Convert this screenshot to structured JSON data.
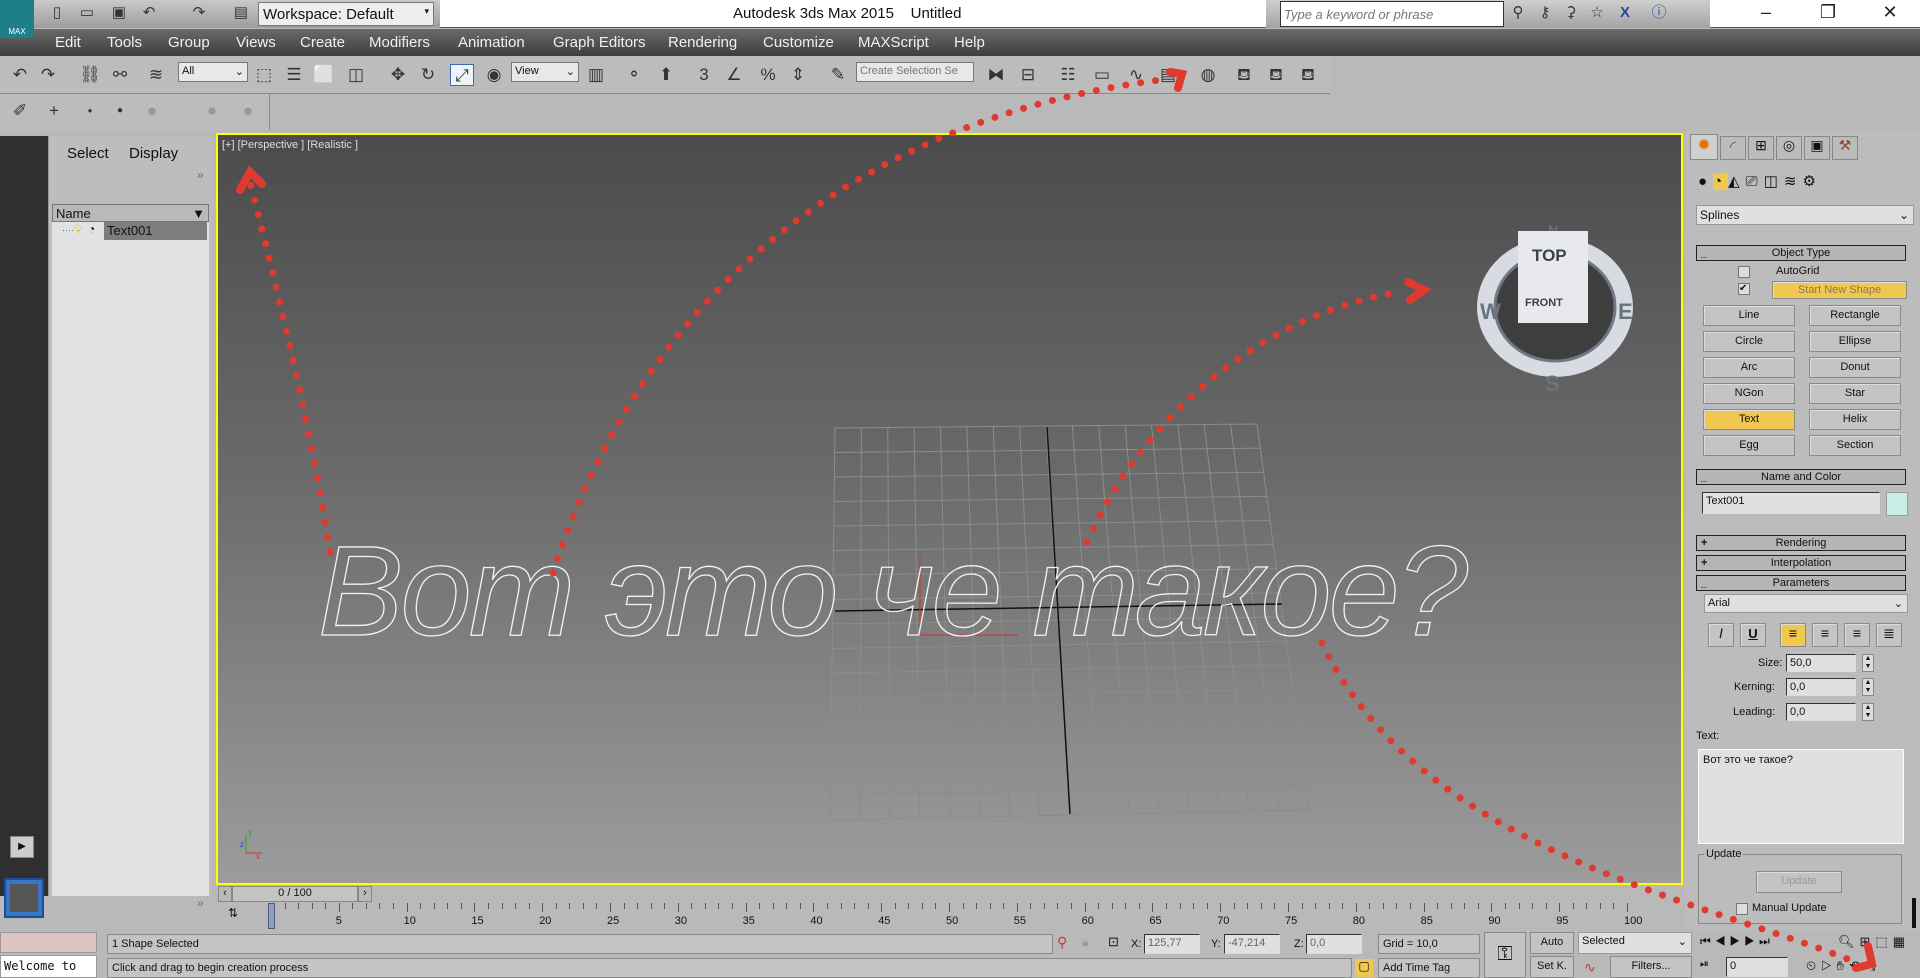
{
  "app": {
    "title": "Autodesk 3ds Max  2015",
    "document": "Untitled",
    "logo": "MAX",
    "workspace": "Workspace: Default",
    "search_placeholder": "Type a keyword or phrase"
  },
  "menu": [
    "Edit",
    "Tools",
    "Group",
    "Views",
    "Create",
    "Modifiers",
    "Animation",
    "Graph Editors",
    "Rendering",
    "Customize",
    "MAXScript",
    "Help"
  ],
  "toolbar": {
    "selection_filter": "All",
    "ref_coord": "View",
    "named_selection_placeholder": "Create Selection Se",
    "snap_3": "3",
    "snap_percent": "%"
  },
  "explorer": {
    "tabs": [
      "Select",
      "Display"
    ],
    "column": "Name",
    "items": [
      {
        "name": "Text001"
      }
    ]
  },
  "viewport": {
    "label": "[+] [Perspective ] [Realistic ]",
    "text": "Вот это че такое?",
    "viewcube": {
      "top": "TOP",
      "front": "FRONT",
      "n": "N",
      "s": "S",
      "e": "E",
      "w": "W"
    },
    "axis_x": "x",
    "axis_y": "y",
    "axis_z": "z"
  },
  "command_panel": {
    "category_dropdown": "Splines",
    "object_type": {
      "title": "Object Type",
      "autogrid": "AutoGrid",
      "autogrid_checked": false,
      "start_new_shape": "Start New Shape",
      "start_new_shape_checked": true,
      "buttons": [
        "Line",
        "Rectangle",
        "Circle",
        "Ellipse",
        "Arc",
        "Donut",
        "NGon",
        "Star",
        "Text",
        "Helix",
        "Egg",
        "Section"
      ],
      "active": "Text"
    },
    "name_color": {
      "title": "Name and Color",
      "name": "Text001",
      "color": "#c8eee6"
    },
    "rendering": "Rendering",
    "interpolation": "Interpolation",
    "parameters": {
      "title": "Parameters",
      "font": "Arial",
      "italic": "I",
      "underline": "U",
      "size_label": "Size:",
      "size": "50,0",
      "kerning_label": "Kerning:",
      "kerning": "0,0",
      "leading_label": "Leading:",
      "leading": "0,0",
      "text_label": "Text:",
      "text": "Вот это че такое?"
    },
    "update": {
      "group": "Update",
      "button": "Update",
      "manual": "Manual Update",
      "manual_checked": false
    }
  },
  "timeline": {
    "slider": "0 / 100",
    "ticks": [
      "0",
      "5",
      "10",
      "15",
      "20",
      "25",
      "30",
      "35",
      "40",
      "45",
      "50",
      "55",
      "60",
      "65",
      "70",
      "75",
      "80",
      "85",
      "90",
      "95",
      "100"
    ]
  },
  "status": {
    "maxscript": "Welcome to",
    "selection": "1 Shape Selected",
    "prompt": "Click and drag to begin creation process",
    "x_label": "X:",
    "x": "125,77",
    "y_label": "Y:",
    "y": "-47,214",
    "z_label": "Z:",
    "z": "0,0",
    "grid": "Grid = 10,0",
    "add_time_tag": "Add Time Tag",
    "auto": "Auto",
    "set_key": "Set K.",
    "key_filter": "Selected",
    "filters": "Filters...",
    "frame": "0"
  },
  "colors": {
    "viewport_border": "#ffff00",
    "active_button": "#f0c850",
    "annotation": "#e03a2f"
  }
}
